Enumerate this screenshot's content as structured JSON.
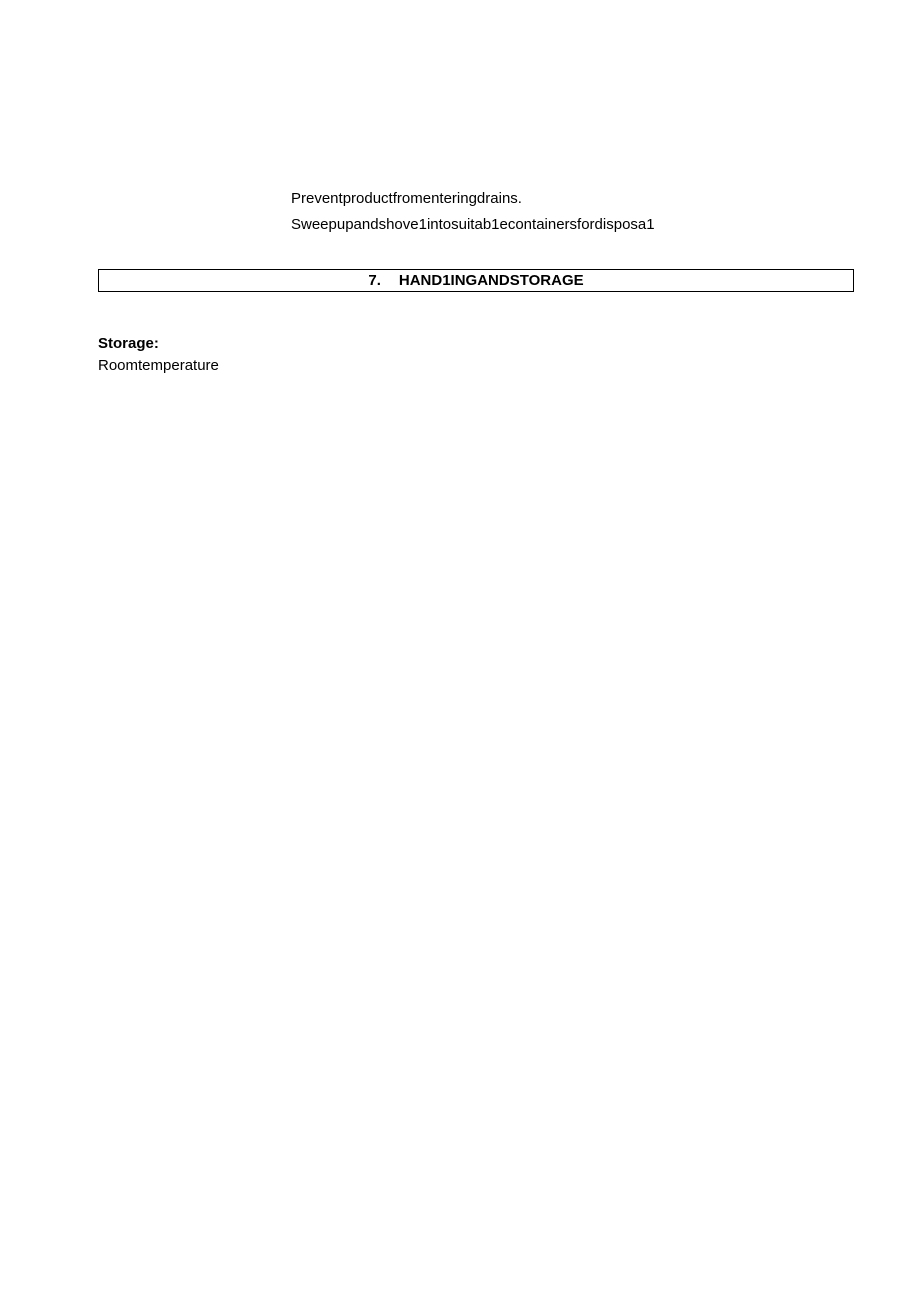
{
  "body": {
    "line1": "Preventproductfromenteringdrains.",
    "line2": "Sweepupandshove1intosuitab1econtainersfordisposa1"
  },
  "section": {
    "number": "7.",
    "title": "HAND1INGANDSTORAGE"
  },
  "storage": {
    "label": "Storage:",
    "value": "Roomtemperature"
  }
}
